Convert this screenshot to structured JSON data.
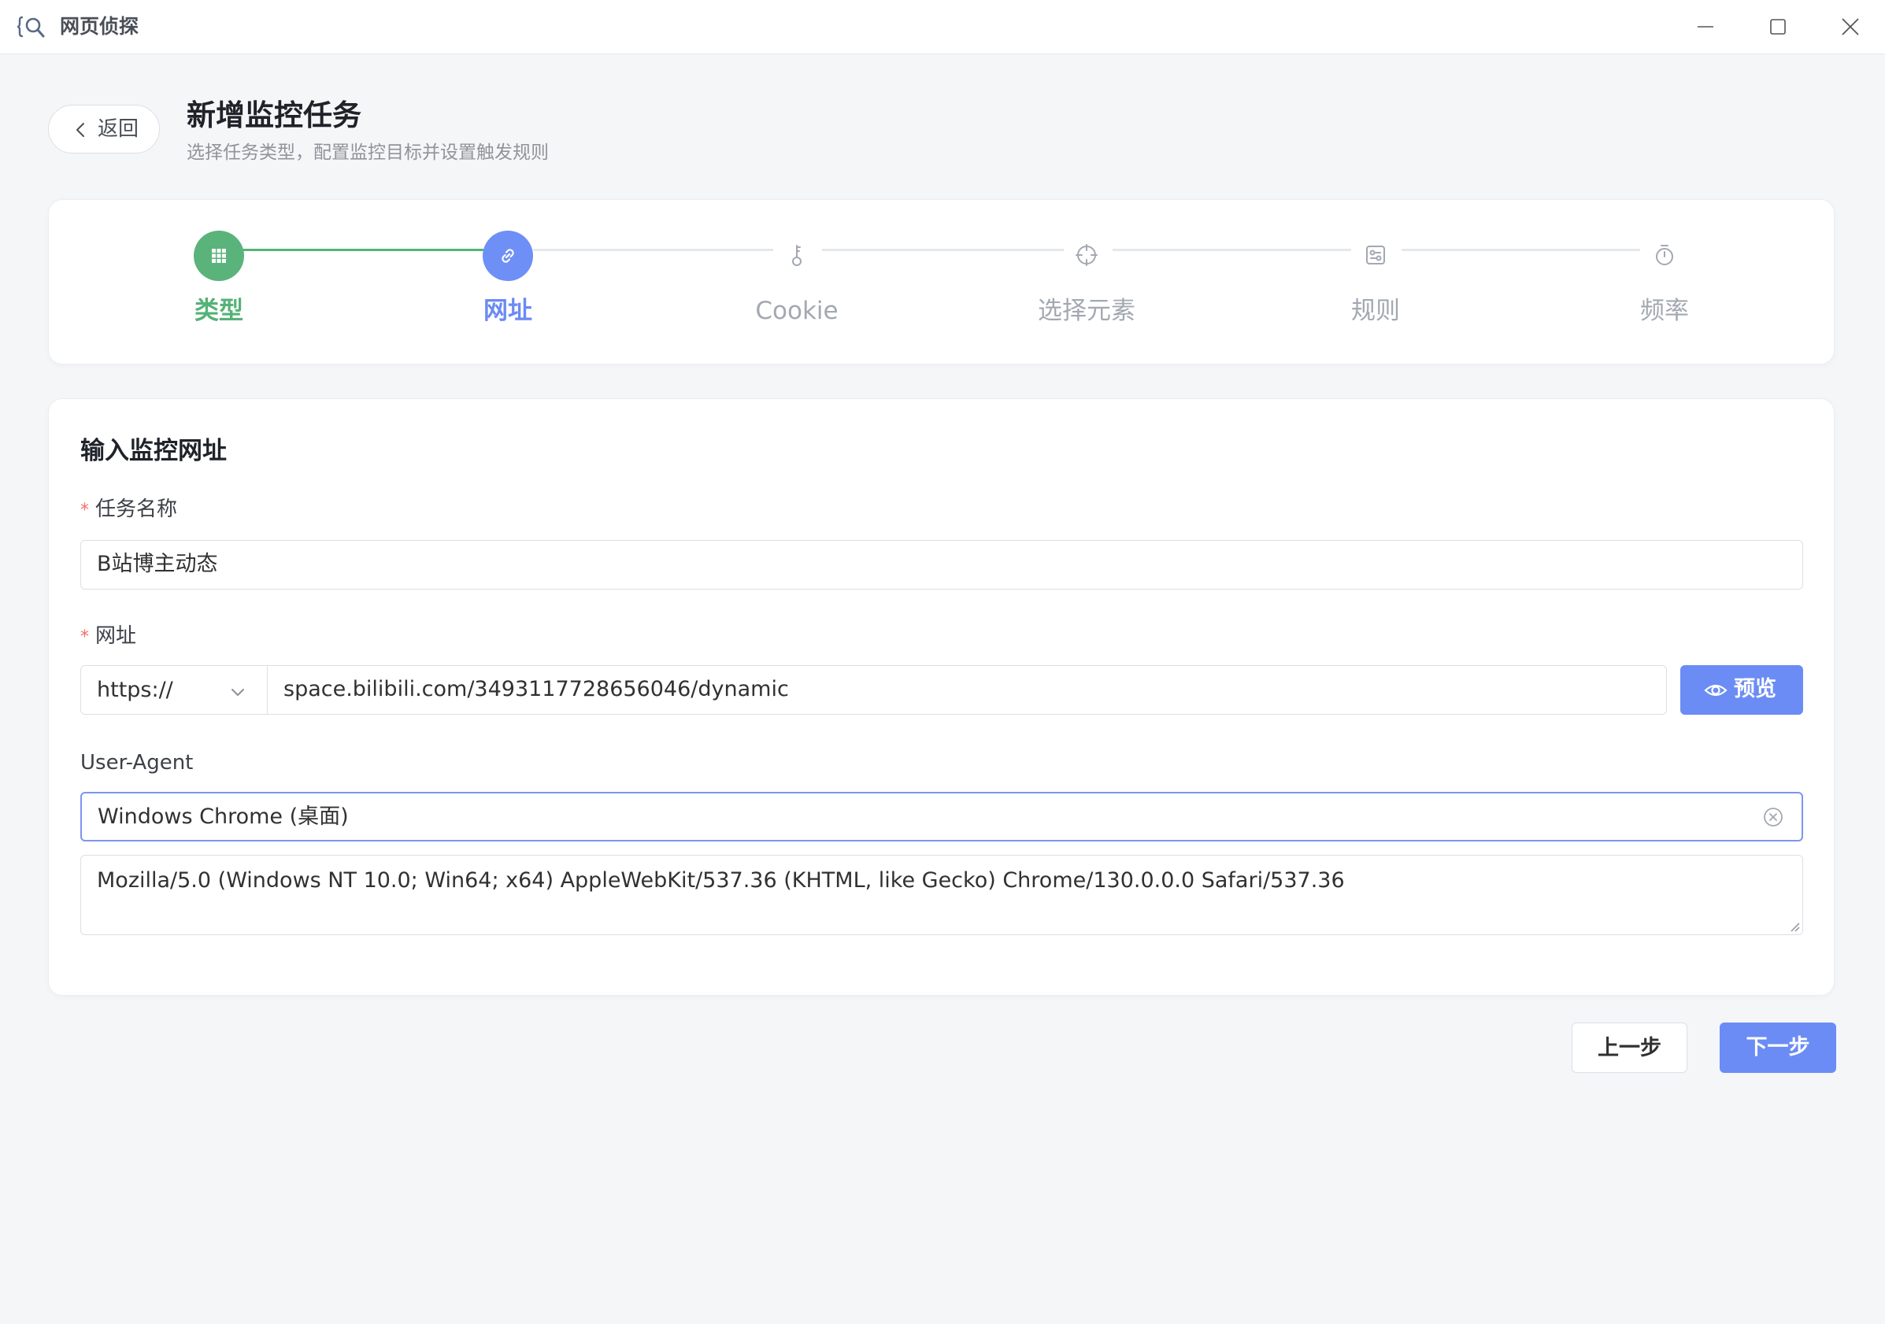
{
  "window": {
    "title": "网页侦探",
    "minimize_icon": "minimize-icon",
    "maximize_icon": "maximize-icon",
    "close_icon": "close-icon"
  },
  "header": {
    "back_label": "返回",
    "title": "新增监控任务",
    "subtitle": "选择任务类型，配置监控目标并设置触发规则"
  },
  "steps": [
    {
      "label": "类型",
      "status": "done",
      "icon": "grid-icon"
    },
    {
      "label": "网址",
      "status": "active",
      "icon": "link-icon"
    },
    {
      "label": "Cookie",
      "status": "pending",
      "icon": "key-icon"
    },
    {
      "label": "选择元素",
      "status": "pending",
      "icon": "crosshair-icon"
    },
    {
      "label": "规则",
      "status": "pending",
      "icon": "rules-icon"
    },
    {
      "label": "频率",
      "status": "pending",
      "icon": "timer-icon"
    }
  ],
  "form": {
    "section_title": "输入监控网址",
    "task_name": {
      "label": "任务名称",
      "required_mark": "*",
      "value": "B站博主动态"
    },
    "url": {
      "label": "网址",
      "required_mark": "*",
      "scheme": "https://",
      "value": "space.bilibili.com/3493117728656046/dynamic",
      "preview_label": "预览"
    },
    "user_agent": {
      "label": "User-Agent",
      "selected": "Windows Chrome (桌面)",
      "value": "Mozilla/5.0 (Windows NT 10.0; Win64; x64) AppleWebKit/537.36 (KHTML, like Gecko) Chrome/130.0.0.0 Safari/537.36"
    }
  },
  "footer": {
    "prev_label": "上一步",
    "next_label": "下一步"
  },
  "colors": {
    "done": "#5ab37a",
    "active": "#6e8ff6",
    "primary_button": "#6b8cf4",
    "required": "#f56c6c"
  }
}
